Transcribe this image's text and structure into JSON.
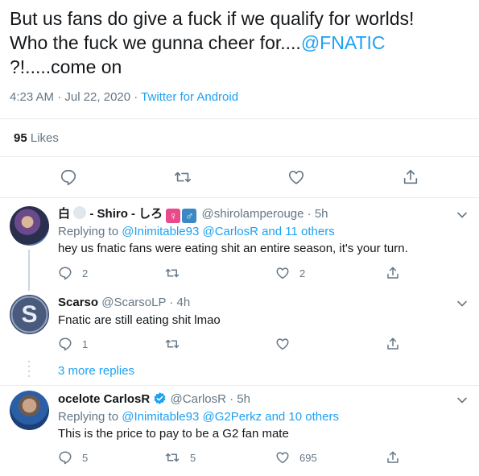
{
  "main_tweet": {
    "text_line1": "But us fans do give a fuck if we qualify for worlds!",
    "text_line2_pre": "Who the fuck we gunna cheer for....",
    "text_mention": "@FNATIC",
    "text_line3": "?!.....come on",
    "timestamp": "4:23 AM · Jul 22, 2020",
    "separator": " · ",
    "source": "Twitter for Android",
    "likes_count": "95",
    "likes_label": "Likes"
  },
  "replies": [
    {
      "name_prefix": "白",
      "name_main": "- Shiro - しろ",
      "gender_female": "♀",
      "gender_male": "♂",
      "handle": "@shirolamperouge",
      "time": " · 5h",
      "replying_label": "Replying to ",
      "replying_targets": "@Inimitable93 @CarlosR and 11 others",
      "text": "hey us fnatic fans were eating shit an entire season, it's your turn.",
      "reply_count": "2",
      "retweet_count": "",
      "like_count": "2"
    },
    {
      "name_main": "Scarso",
      "handle": "@ScarsoLP",
      "time": " · 4h",
      "text": "Fnatic are still eating shit lmao",
      "reply_count": "1",
      "retweet_count": "",
      "like_count": ""
    },
    {
      "name_main": "ocelote CarlosR",
      "handle": "@CarlosR",
      "time": " · 5h",
      "replying_label": "Replying to ",
      "replying_targets": "@Inimitable93 @G2Perkz and 10 others",
      "text": "This is the price to pay to be a G2 fan mate",
      "reply_count": "5",
      "retweet_count": "5",
      "like_count": "695"
    }
  ],
  "more_replies": "3 more replies",
  "colors": {
    "accent": "#1da1f2",
    "muted": "#657786",
    "divider": "#e6ecf0"
  }
}
